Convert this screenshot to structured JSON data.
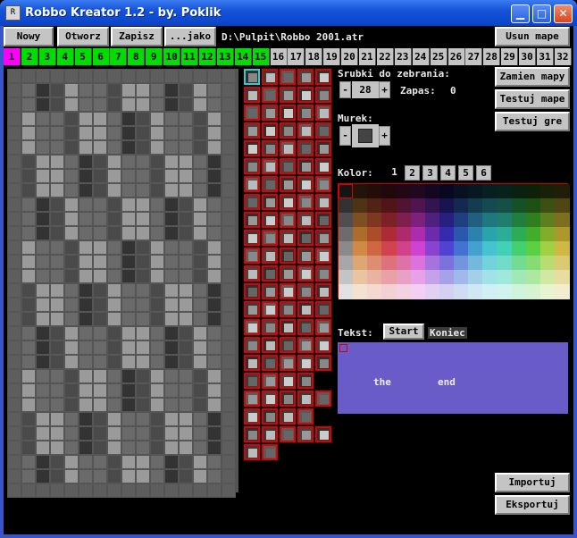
{
  "window": {
    "title": "Robbo Kreator 1.2 - by. Poklik",
    "icon_label": "R"
  },
  "toolbar": {
    "new": "Nowy",
    "open": "Otworz",
    "save": "Zapisz",
    "save_as": "...jako",
    "path": "D:\\Pulpit\\Robbo 2001.atr"
  },
  "right_buttons": {
    "delete_map": "Usun mape",
    "swap_maps": "Zamien mapy",
    "test_map": "Testuj mape",
    "test_game": "Testuj gre",
    "import": "Importuj",
    "export": "Eksportuj"
  },
  "levels": {
    "items": [
      "1",
      "2",
      "3",
      "4",
      "5",
      "6",
      "7",
      "8",
      "9",
      "10",
      "11",
      "12",
      "13",
      "14",
      "15",
      "16",
      "17",
      "18",
      "19",
      "20",
      "21",
      "22",
      "23",
      "24",
      "25",
      "26",
      "27",
      "28",
      "29",
      "30",
      "31",
      "32"
    ],
    "active": "1",
    "filled_count": 15
  },
  "screws": {
    "label": "Srubki do zebrania:",
    "value": "28",
    "minus": "-",
    "plus": "+",
    "spare_label": "Zapas:",
    "spare_value": "0"
  },
  "wall": {
    "label": "Murek:",
    "minus": "-",
    "plus": "+"
  },
  "color": {
    "label": "Kolor:",
    "tabs": [
      "1",
      "2",
      "3",
      "4",
      "5",
      "6"
    ]
  },
  "text": {
    "label": "Tekst:",
    "start": "Start",
    "end": "Koniec",
    "line1": "the",
    "line2": "end"
  },
  "theme": {
    "accent": "#0a43c8",
    "level_active": "#ff00ff",
    "level_filled": "#00dd00",
    "level_empty": "#c4c4c4",
    "text_bg": "#6a5cc8"
  }
}
